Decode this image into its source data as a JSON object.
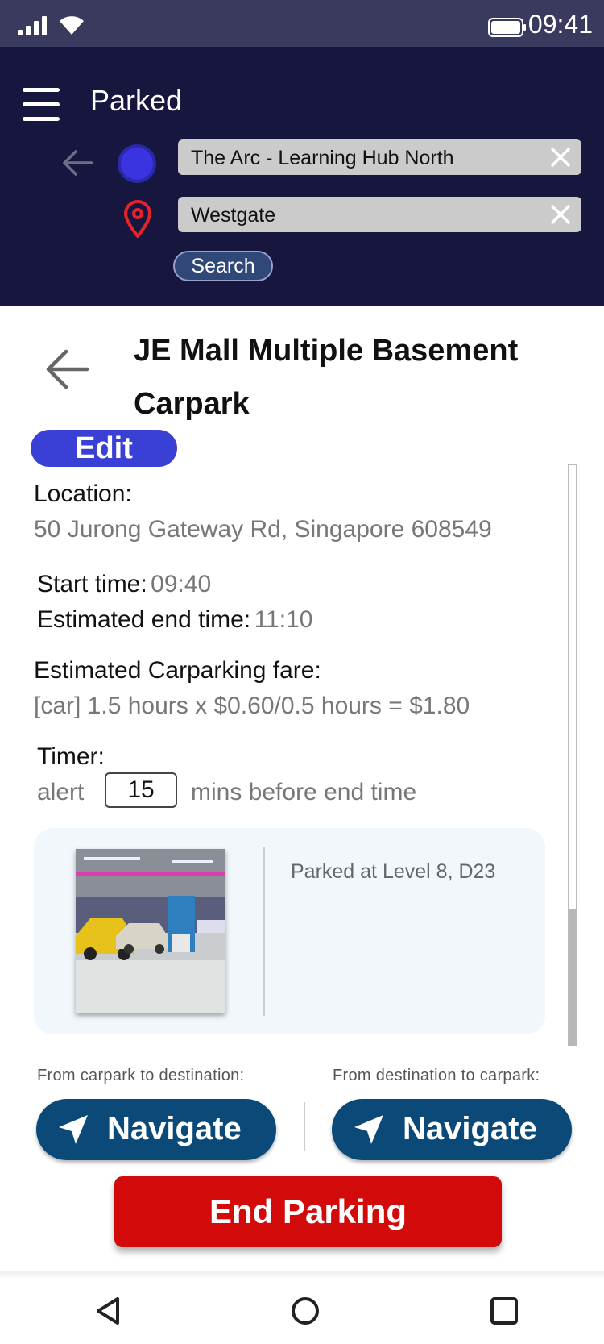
{
  "status": {
    "time": "09:41"
  },
  "header": {
    "title": "Parked",
    "origin": "The Arc - Learning Hub North",
    "destination": "Westgate",
    "search_label": "Search"
  },
  "carpark": {
    "name": "JE Mall Multiple Basement Carpark",
    "edit_label": "Edit",
    "location_label": "Location:",
    "location_value": "50 Jurong Gateway Rd, Singapore 608549",
    "start_label": "Start time:",
    "start_value": "09:40",
    "end_label": "Estimated end time:",
    "end_value": "11:10",
    "fare_label": "Estimated Carparking fare:",
    "fare_value": "[car] 1.5 hours x $0.60/0.5 hours = $1.80",
    "timer_label": "Timer:",
    "timer_prefix": "alert",
    "timer_value": "15",
    "timer_suffix": "mins before end time",
    "parked_at": "Parked at Level 8, D23"
  },
  "navigation": {
    "to_destination_label": "From carpark to destination:",
    "to_carpark_label": "From destination to carpark:",
    "navigate_label": "Navigate"
  },
  "end_parking_label": "End Parking",
  "colors": {
    "header_bg": "#16163f",
    "edit_button": "#3a3fd6",
    "navigate_button": "#0b4a78",
    "end_button": "#d20a0a"
  }
}
